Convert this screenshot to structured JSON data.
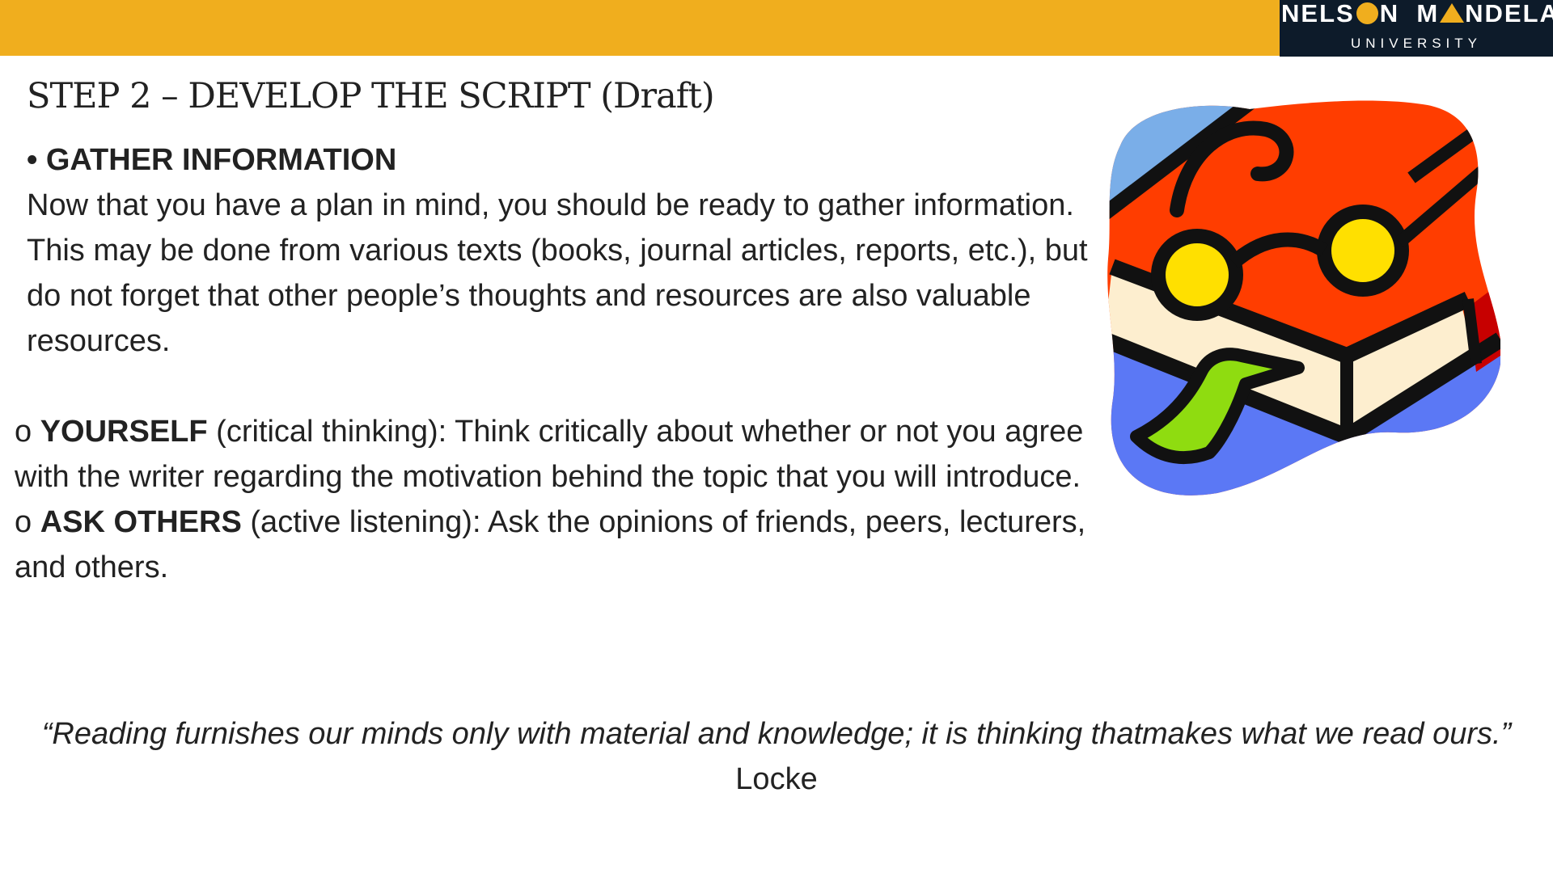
{
  "header": {
    "logo": {
      "line1_part1": "NELS",
      "line1_part2": "N",
      "line1_part3": "M",
      "line1_part4": "NDELA",
      "line2": "UNIVERSITY"
    },
    "colors": {
      "bar": "#f0ae1e",
      "logo_bg": "#0d1b2a"
    }
  },
  "slide": {
    "title": "STEP 2 – DEVELOP THE SCRIPT (Draft)",
    "gather": {
      "heading": "• GATHER INFORMATION",
      "paragraph": "Now that you have a plan in mind, you should be ready to gather information.  This may be done from various texts (books, journal articles, reports, etc.), but do not forget that other people’s thoughts and resources are also valuable resources."
    },
    "points": [
      {
        "bullet": "o ",
        "label": "YOURSELF",
        "text": " (critical thinking): Think critically about whether or not you agree with the writer regarding the motivation behind the topic that you will introduce."
      },
      {
        "bullet": "o ",
        "label": "ASK OTHERS",
        "text": " (active listening): Ask the opinions of friends, peers, lecturers, and others."
      }
    ],
    "quote": {
      "text": "“Reading furnishes our minds only with material and knowledge; it is thinking thatmakes what we read ours.”",
      "author": "Locke"
    },
    "illustration": {
      "icon": "reading-book-with-glasses-icon"
    }
  }
}
